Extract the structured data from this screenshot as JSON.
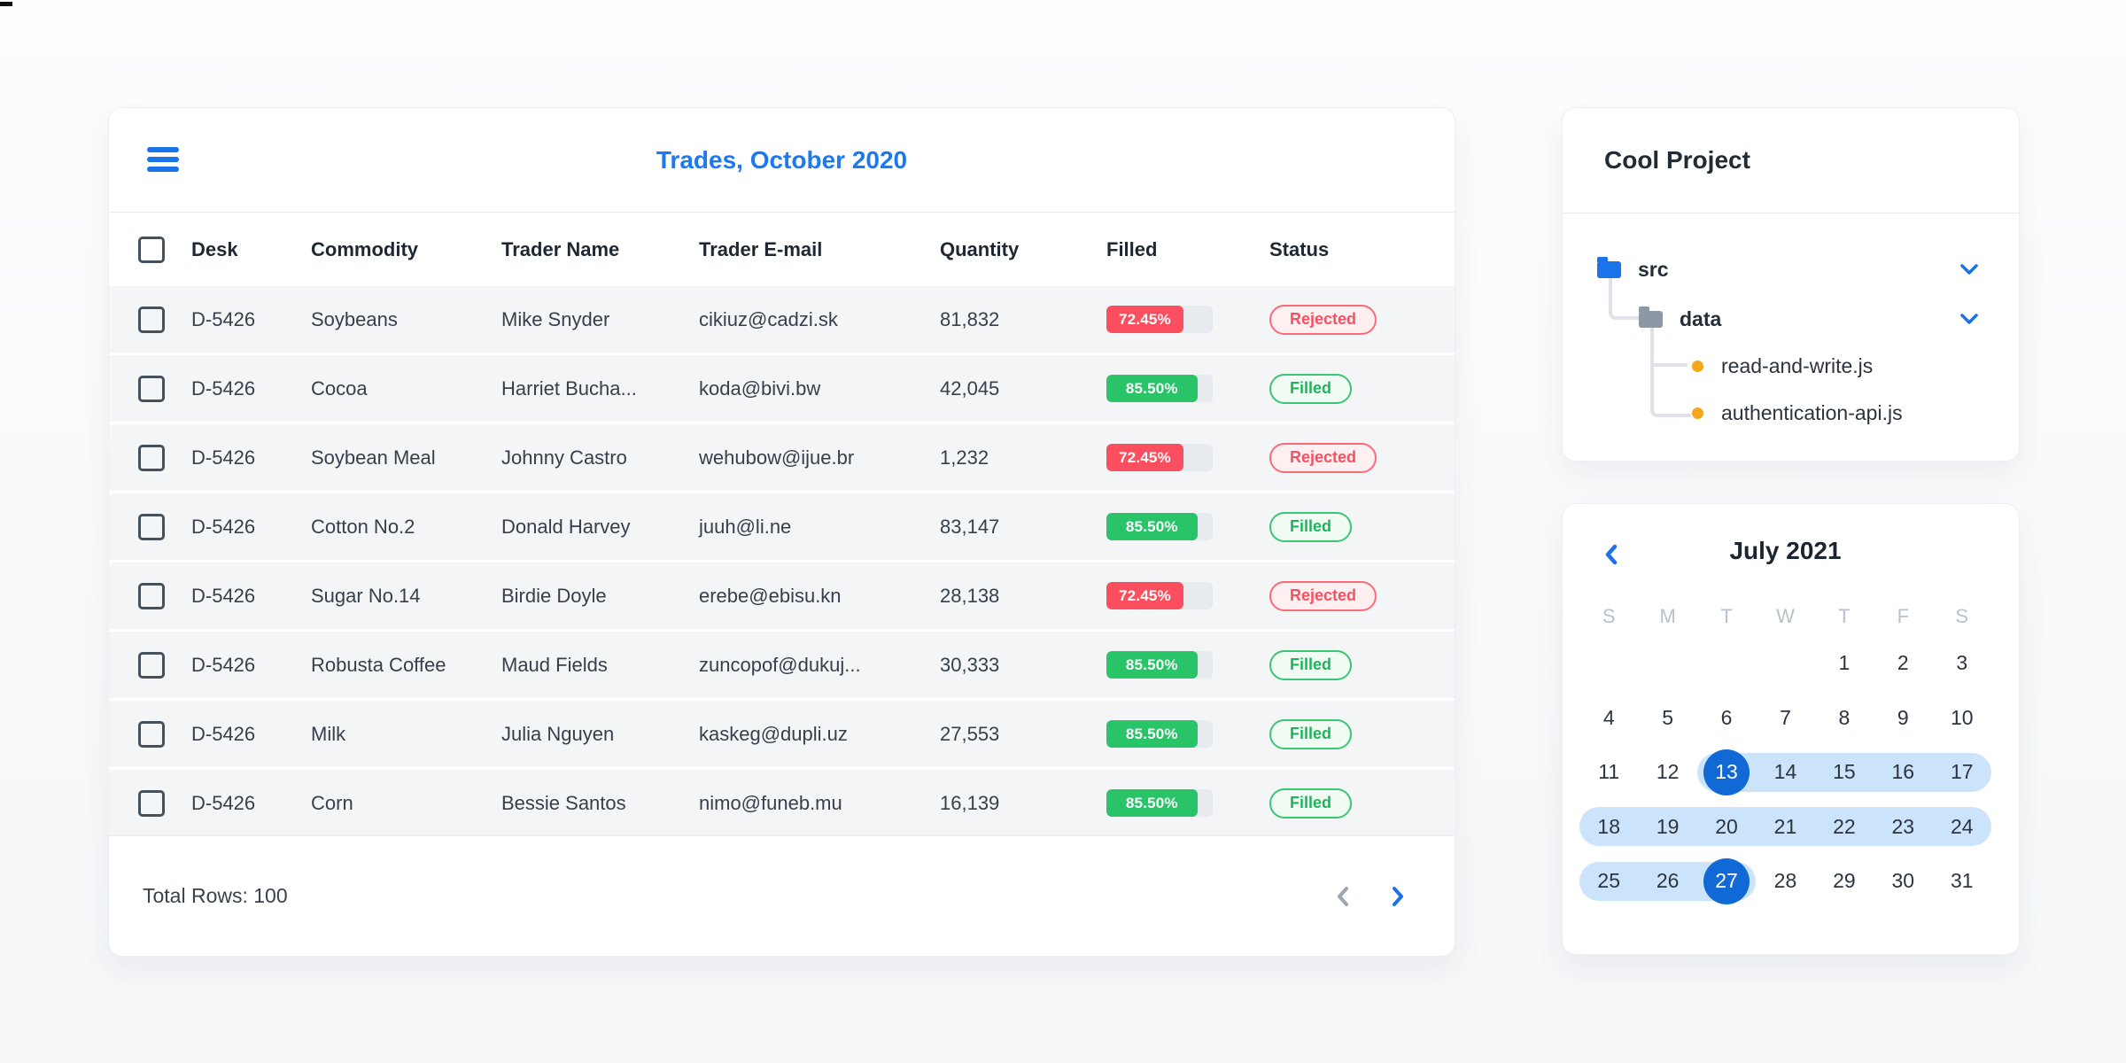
{
  "colors": {
    "accent_blue": "#1a73e8",
    "title_blue": "#1c79f2",
    "selected_day_blue": "#1169d6",
    "range_band_blue": "#cce4fb",
    "red": "#fb4e5f",
    "green": "#29c368",
    "row_bg": "#f3f5f7",
    "track_gray": "#e7eaee",
    "muted_gray": "#9aa6b2",
    "file_dot_orange": "#f3a71b",
    "folder_gray": "#8d98a5"
  },
  "icons": {
    "menu": "hamburger-icon",
    "chevron_left": "chevron-left-icon",
    "chevron_right": "chevron-right-icon",
    "chevron_down": "chevron-down-icon",
    "folder": "folder-icon",
    "file_bullet": "dot-icon",
    "checkbox": "checkbox-icon"
  },
  "table": {
    "title": "Trades, October 2020",
    "columns": [
      "Desk",
      "Commodity",
      "Trader Name",
      "Trader E-mail",
      "Quantity",
      "Filled",
      "Status"
    ],
    "rows": [
      {
        "desk": "D-5426",
        "commodity": "Soybeans",
        "trader": "Mike Snyder",
        "email": "cikiuz@cadzi.sk",
        "quantity": "81,832",
        "filled_label": "72.45%",
        "filled_value": 72.45,
        "status": "Rejected"
      },
      {
        "desk": "D-5426",
        "commodity": "Cocoa",
        "trader": "Harriet Bucha...",
        "email": "koda@bivi.bw",
        "quantity": "42,045",
        "filled_label": "85.50%",
        "filled_value": 85.5,
        "status": "Filled"
      },
      {
        "desk": "D-5426",
        "commodity": "Soybean Meal",
        "trader": "Johnny Castro",
        "email": "wehubow@ijue.br",
        "quantity": "1,232",
        "filled_label": "72.45%",
        "filled_value": 72.45,
        "status": "Rejected"
      },
      {
        "desk": "D-5426",
        "commodity": "Cotton No.2",
        "trader": "Donald Harvey",
        "email": "juuh@li.ne",
        "quantity": "83,147",
        "filled_label": "85.50%",
        "filled_value": 85.5,
        "status": "Filled"
      },
      {
        "desk": "D-5426",
        "commodity": "Sugar No.14",
        "trader": "Birdie Doyle",
        "email": "erebe@ebisu.kn",
        "quantity": "28,138",
        "filled_label": "72.45%",
        "filled_value": 72.45,
        "status": "Rejected"
      },
      {
        "desk": "D-5426",
        "commodity": "Robusta Coffee",
        "trader": "Maud Fields",
        "email": "zuncopof@dukuj...",
        "quantity": "30,333",
        "filled_label": "85.50%",
        "filled_value": 85.5,
        "status": "Filled"
      },
      {
        "desk": "D-5426",
        "commodity": "Milk",
        "trader": "Julia Nguyen",
        "email": "kaskeg@dupli.uz",
        "quantity": "27,553",
        "filled_label": "85.50%",
        "filled_value": 85.5,
        "status": "Filled"
      },
      {
        "desk": "D-5426",
        "commodity": "Corn",
        "trader": "Bessie Santos",
        "email": "nimo@funeb.mu",
        "quantity": "16,139",
        "filled_label": "85.50%",
        "filled_value": 85.5,
        "status": "Filled"
      }
    ],
    "footer": {
      "total": "Total Rows: 100"
    }
  },
  "file_tree": {
    "title": "Cool Project",
    "items": [
      {
        "name": "src",
        "type": "folder",
        "expanded": true
      },
      {
        "name": "data",
        "type": "folder",
        "expanded": true
      },
      {
        "name": "read-and-write.js",
        "type": "file"
      },
      {
        "name": "authentication-api.js",
        "type": "file"
      }
    ]
  },
  "calendar": {
    "title": "July 2021",
    "weekdays": [
      "S",
      "M",
      "T",
      "W",
      "T",
      "F",
      "S"
    ],
    "weeks": [
      [
        null,
        null,
        null,
        null,
        1,
        2,
        3
      ],
      [
        4,
        5,
        6,
        7,
        8,
        9,
        10
      ],
      [
        11,
        12,
        13,
        14,
        15,
        16,
        17
      ],
      [
        18,
        19,
        20,
        21,
        22,
        23,
        24
      ],
      [
        25,
        26,
        27,
        28,
        29,
        30,
        31
      ]
    ],
    "range": {
      "start": 13,
      "end": 27
    },
    "selected": [
      13,
      27
    ]
  }
}
